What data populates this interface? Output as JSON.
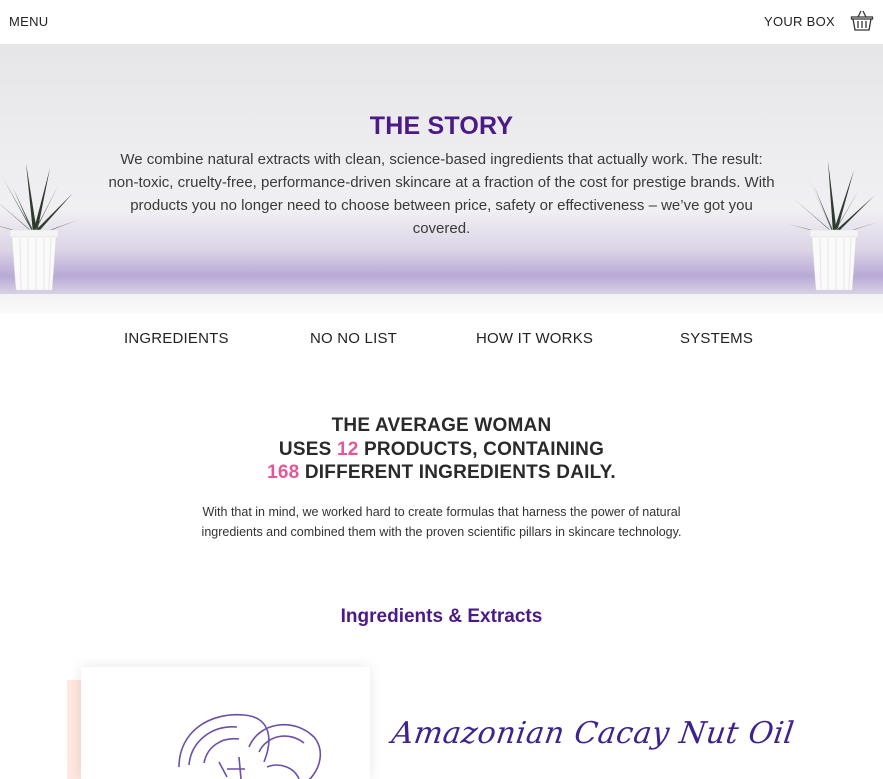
{
  "header": {
    "menu_label": "MENU",
    "box_label": "YOUR BOX",
    "basket_icon": "basket-icon"
  },
  "hero": {
    "title": "THE STORY",
    "text": "We combine natural extracts with clean, science-based ingredients that actually work. The result: non-toxic, cruelty-free, performance-driven skincare at a fraction of the cost for prestige brands. With products you no longer need to choose between price, safety or effectiveness – we’ve got you covered.",
    "plant_icon": "potted-plant-icon"
  },
  "tabs": [
    {
      "label": "INGREDIENTS"
    },
    {
      "label": "NO NO LIST"
    },
    {
      "label": "HOW IT WORKS"
    },
    {
      "label": "SYSTEMS"
    }
  ],
  "stats": {
    "line1": "THE AVERAGE WOMAN",
    "line2_pre": "USES ",
    "products_count": "12",
    "line2_post": " PRODUCTS, CONTAINING",
    "ingredients_count": "168",
    "line3_post": " DIFFERENT INGREDIENTS DAILY.",
    "description": "With that in mind, we worked hard to create formulas that harness the power of natural ingredients and combined them with the proven scientific pillars in skincare technology."
  },
  "ingredients": {
    "section_title": "Ingredients & Extracts",
    "items": [
      {
        "name": "Amazonian Cacay Nut Oil",
        "illustration": "nut-illustration-icon"
      }
    ]
  },
  "colors": {
    "brand_purple": "#4b1a86",
    "accent_pink": "#e4579b"
  }
}
